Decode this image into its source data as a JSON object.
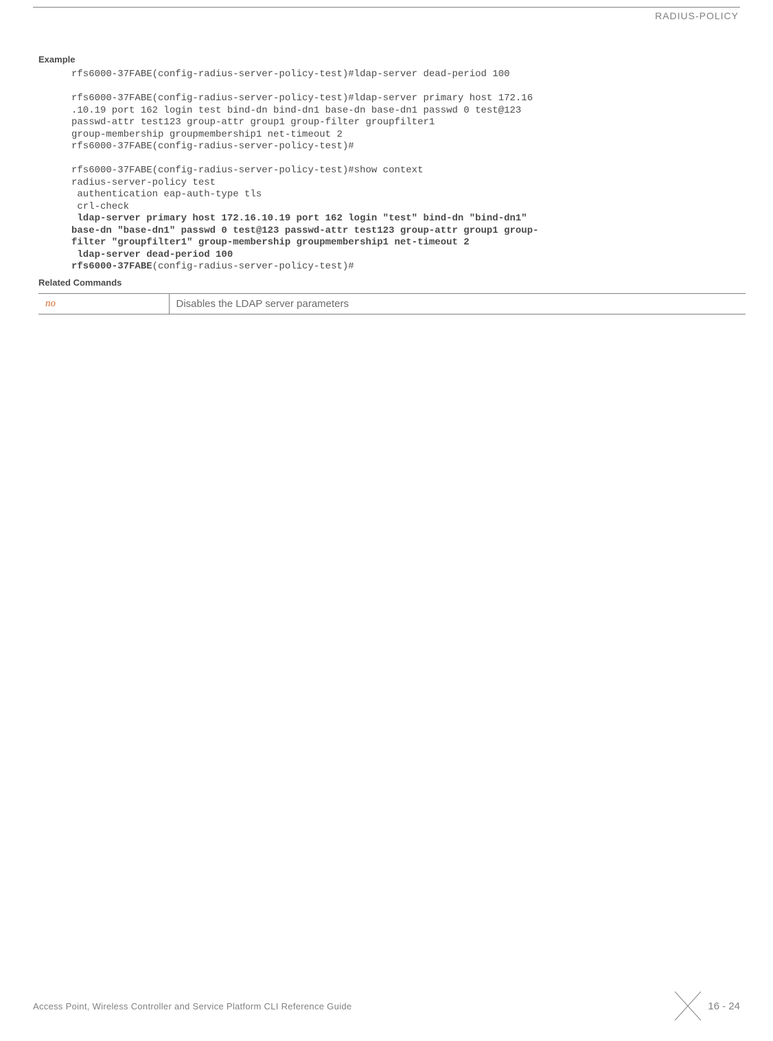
{
  "header": {
    "title": "RADIUS-POLICY"
  },
  "sections": {
    "example_heading": "Example",
    "related_heading": "Related Commands"
  },
  "code": {
    "line1": "rfs6000-37FABE(config-radius-server-policy-test)#ldap-server dead-period 100",
    "line2": "rfs6000-37FABE(config-radius-server-policy-test)#ldap-server primary host 172.16",
    "line3": ".10.19 port 162 login test bind-dn bind-dn1 base-dn base-dn1 passwd 0 test@123 ",
    "line4": "passwd-attr test123 group-attr group1 group-filter groupfilter1",
    "line5": "group-membership groupmembership1 net-timeout 2",
    "line6": "rfs6000-37FABE(config-radius-server-policy-test)#",
    "line7": "rfs6000-37FABE(config-radius-server-policy-test)#show context",
    "line8": "radius-server-policy test",
    "line9": " authentication eap-auth-type tls",
    "line10": " crl-check",
    "bold1": " ldap-server primary host 172.16.10.19 port 162 login \"test\" bind-dn \"bind-dn1\" ",
    "bold2": "base-dn \"base-dn1\" passwd 0 test@123 passwd-attr test123 group-attr group1 group-",
    "bold3": "filter \"groupfilter1\" group-membership groupmembership1 net-timeout 2",
    "bold4": " ldap-server dead-period 100",
    "bold5": "rfs6000-37FABE",
    "tail5": "(config-radius-server-policy-test)#"
  },
  "table": {
    "cmd": "no",
    "desc": "Disables the LDAP server parameters"
  },
  "footer": {
    "text": "Access Point, Wireless Controller and Service Platform CLI Reference Guide",
    "page": "16 - 24"
  }
}
